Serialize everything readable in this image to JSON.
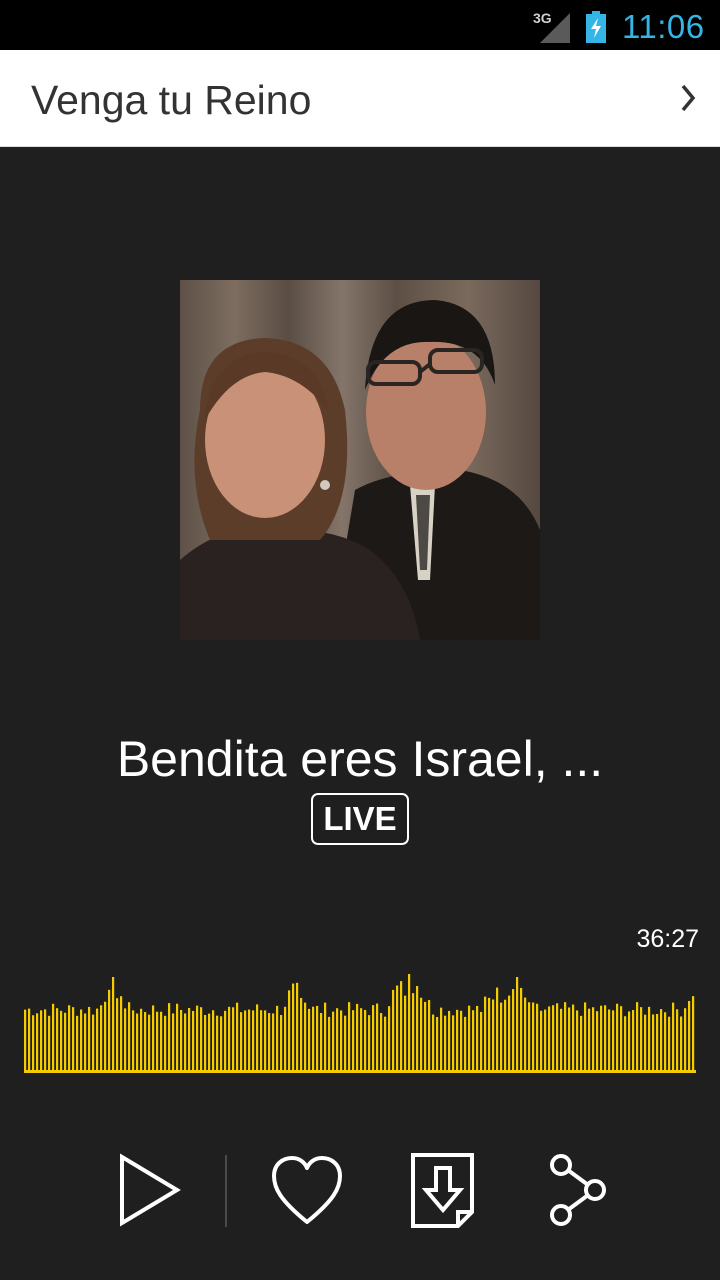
{
  "status_bar": {
    "network": "3G",
    "time": "11:06",
    "signal_icon": "signal-icon",
    "battery_icon": "battery-charging-icon",
    "clock_color": "#33b5e5"
  },
  "app_bar": {
    "title": "Venga tu Reino",
    "next_icon": "chevron-right-icon"
  },
  "player": {
    "track_title": "Bendita eres Israel, ...",
    "live_label": "LIVE",
    "duration": "36:27",
    "waveform_color": "#f5cc00"
  },
  "controls": {
    "play_icon": "play-icon",
    "favorite_icon": "heart-icon",
    "download_icon": "download-icon",
    "share_icon": "share-icon"
  }
}
